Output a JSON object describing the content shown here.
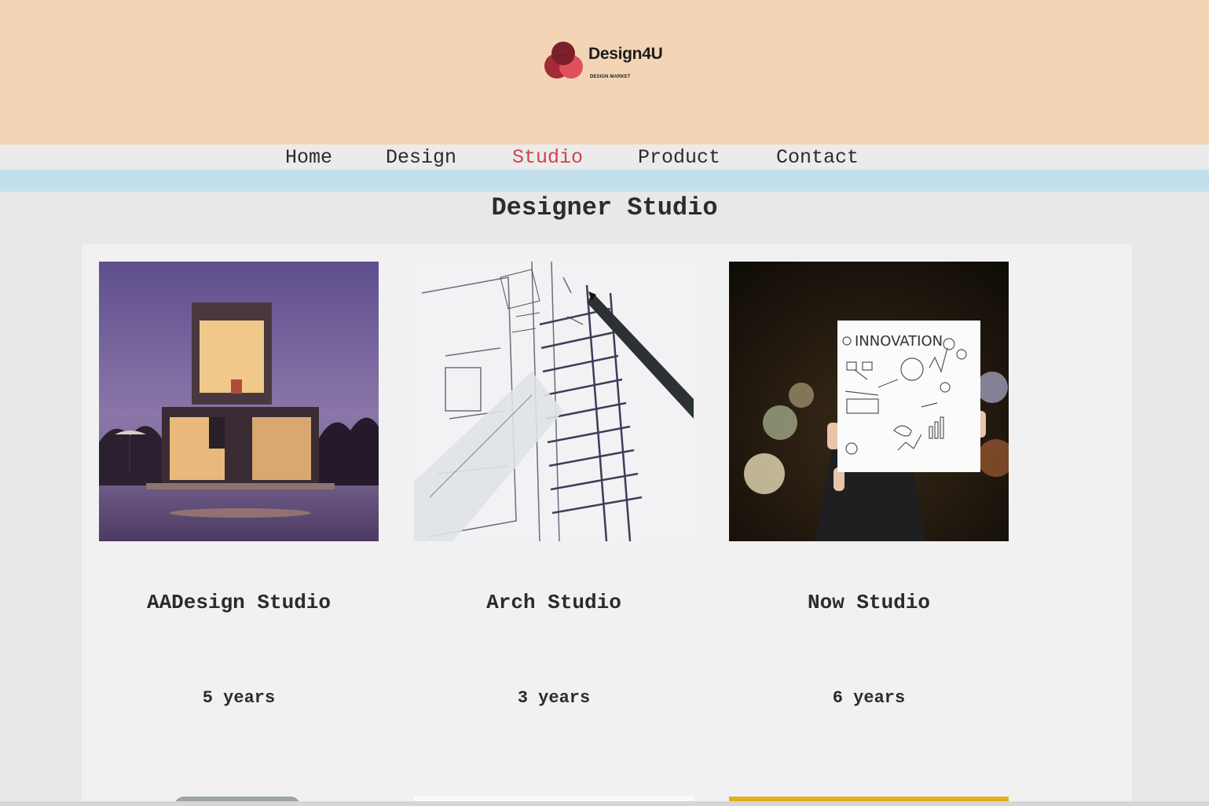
{
  "brand": {
    "name": "Design4U",
    "tagline": "DESIGN MARKET",
    "colors": {
      "header_bg": "#f3d5b5",
      "accent": "#d0434b",
      "stripe": "#c3dfee",
      "logo_dark": "#7a1f2b",
      "logo_red": "#e0505b"
    }
  },
  "nav": {
    "items": [
      {
        "label": "Home",
        "active": false
      },
      {
        "label": "Design",
        "active": false
      },
      {
        "label": "Studio",
        "active": true
      },
      {
        "label": "Product",
        "active": false
      },
      {
        "label": "Contact",
        "active": false
      }
    ]
  },
  "page": {
    "title": "Designer Studio"
  },
  "studios": [
    {
      "name": "AADesign Studio",
      "years": "5 years",
      "image": "modern-house-pool-photo"
    },
    {
      "name": "Arch Studio",
      "years": "3 years",
      "image": "architectural-blueprint-pen-photo"
    },
    {
      "name": "Now Studio",
      "years": "6 years",
      "image": "innovation-poster-photo",
      "poster_text": "INNOVATION"
    }
  ]
}
